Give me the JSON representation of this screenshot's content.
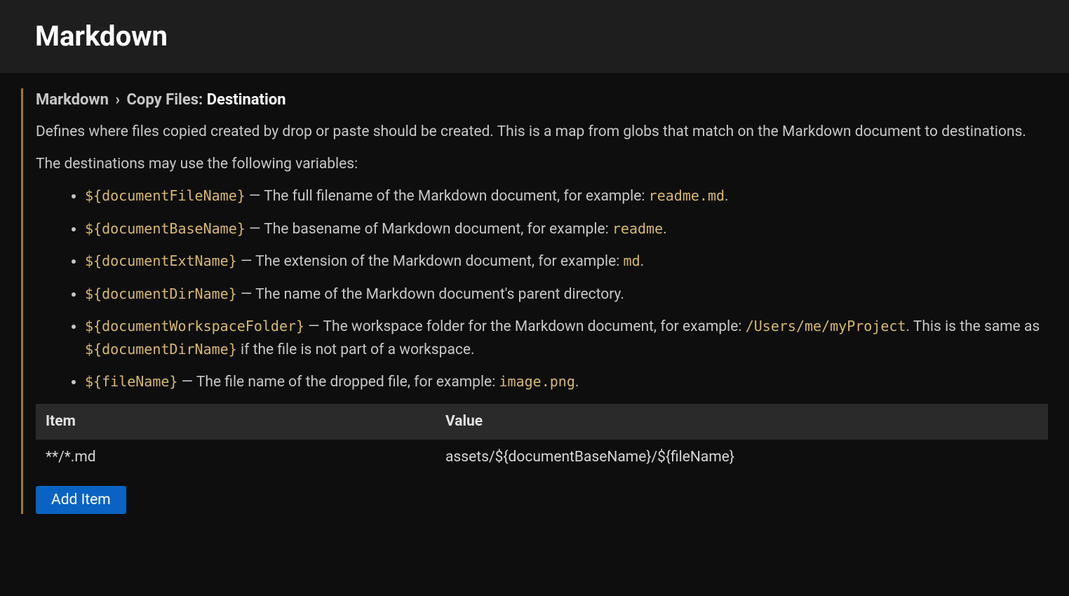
{
  "header": {
    "title": "Markdown"
  },
  "setting": {
    "breadcrumb_parent": "Markdown",
    "breadcrumb_group": "Copy Files:",
    "breadcrumb_leaf": "Destination",
    "chevron": "›",
    "description_p1": "Defines where files copied created by drop or paste should be created. This is a map from globs that match on the Markdown document to destinations.",
    "description_p2": "The destinations may use the following variables:",
    "variables": [
      {
        "var": "${documentFileName}",
        "sep": " — ",
        "before": "The full filename of the Markdown document, for example: ",
        "code": "readme.md",
        "after": "."
      },
      {
        "var": "${documentBaseName}",
        "sep": " — ",
        "before": "The basename of Markdown document, for example: ",
        "code": "readme",
        "after": "."
      },
      {
        "var": "${documentExtName}",
        "sep": " — ",
        "before": "The extension of the Markdown document, for example: ",
        "code": "md",
        "after": "."
      },
      {
        "var": "${documentDirName}",
        "sep": " — ",
        "before": "The name of the Markdown document's parent directory.",
        "code": "",
        "after": ""
      },
      {
        "var": "${documentWorkspaceFolder}",
        "sep": " — ",
        "before": "The workspace folder for the Markdown document, for example: ",
        "code": "/Users/me/myProject",
        "after": ". This is the same as ",
        "code2": "${documentDirName}",
        "after2": " if the file is not part of a workspace."
      },
      {
        "var": "${fileName}",
        "sep": " — ",
        "before": "The file name of the dropped file, for example: ",
        "code": "image.png",
        "after": "."
      }
    ],
    "table": {
      "header_item": "Item",
      "header_value": "Value",
      "rows": [
        {
          "item": "**/*.md",
          "value": "assets/${documentBaseName}/${fileName}"
        }
      ]
    },
    "add_button_label": "Add Item"
  }
}
